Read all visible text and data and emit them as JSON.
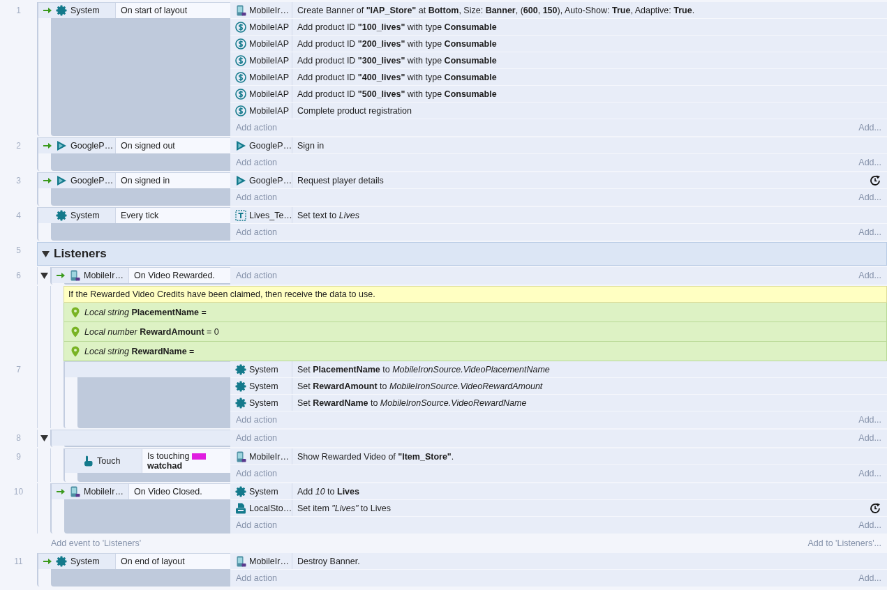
{
  "events": [
    {
      "kind": "event",
      "number": "1",
      "trigger": true,
      "conditions": [
        {
          "kind": "system",
          "object": "System",
          "text": "On start of layout"
        }
      ],
      "actions": [
        {
          "kind": "ironsource",
          "object": "MobileIr…",
          "text": "Create Banner of **\"IAP_Store\"** at **Bottom**, Size: **Banner**, (**600**, **150**), Auto-Show: **True**, Adaptive: **True**.",
          "async": false
        },
        {
          "kind": "iap",
          "object": "MobileIAP",
          "text": "Add product ID **\"100_lives\"** with type **Consumable**",
          "async": false
        },
        {
          "kind": "iap",
          "object": "MobileIAP",
          "text": "Add product ID **\"200_lives\"** with type **Consumable**",
          "async": false
        },
        {
          "kind": "iap",
          "object": "MobileIAP",
          "text": "Add product ID **\"300_lives\"** with type **Consumable**",
          "async": false
        },
        {
          "kind": "iap",
          "object": "MobileIAP",
          "text": "Add product ID **\"400_lives\"** with type **Consumable**",
          "async": false
        },
        {
          "kind": "iap",
          "object": "MobileIAP",
          "text": "Add product ID **\"500_lives\"** with type **Consumable**",
          "async": false
        },
        {
          "kind": "iap",
          "object": "MobileIAP",
          "text": "Complete product registration",
          "async": false
        }
      ],
      "add_action": "Add action",
      "add_more": "Add..."
    },
    {
      "kind": "event",
      "number": "2",
      "trigger": true,
      "conditions": [
        {
          "kind": "play",
          "object": "GoogleP…",
          "text": "On signed out"
        }
      ],
      "actions": [
        {
          "kind": "play",
          "object": "GoogleP…",
          "text": "Sign in",
          "async": false
        }
      ],
      "add_action": "Add action",
      "add_more": "Add..."
    },
    {
      "kind": "event",
      "number": "3",
      "trigger": true,
      "conditions": [
        {
          "kind": "play",
          "object": "GoogleP…",
          "text": "On signed in"
        }
      ],
      "actions": [
        {
          "kind": "play",
          "object": "GoogleP…",
          "text": "Request player details",
          "async": true
        }
      ],
      "add_action": "Add action",
      "add_more": "Add..."
    },
    {
      "kind": "event",
      "number": "4",
      "trigger": false,
      "conditions": [
        {
          "kind": "system",
          "object": "System",
          "text": "Every tick"
        }
      ],
      "actions": [
        {
          "kind": "text",
          "object": "Lives_Te…",
          "text": "Set text to *Lives*",
          "async": false
        }
      ],
      "add_action": "Add action",
      "add_more": "Add..."
    },
    {
      "kind": "group",
      "number": "5",
      "title": "Listeners",
      "expanded": true,
      "add_event": "Add event to 'Listeners'",
      "add_to": "Add to 'Listeners'...",
      "children": [
        {
          "kind": "event",
          "number": "6",
          "trigger": true,
          "expanded": true,
          "conditions": [
            {
              "kind": "ironsource",
              "object": "MobileIr…",
              "text": "On Video Rewarded."
            }
          ],
          "add_action": "Add action",
          "add_more": "Add...",
          "children": [
            {
              "kind": "comment",
              "text": "If the Rewarded Video Credits have been claimed, then receive the data to use."
            },
            {
              "kind": "variable",
              "text": "*Local string* **PlacementName** ="
            },
            {
              "kind": "variable",
              "text": "*Local number* **RewardAmount** = 0"
            },
            {
              "kind": "variable",
              "text": "*Local string* **RewardName** ="
            },
            {
              "kind": "event",
              "number": "7",
              "actions": [
                {
                  "kind": "system",
                  "object": "System",
                  "text": "Set **PlacementName** to *MobileIronSource.VideoPlacementName*",
                  "async": false
                },
                {
                  "kind": "system",
                  "object": "System",
                  "text": "Set **RewardAmount** to *MobileIronSource.VideoRewardAmount*",
                  "async": false
                },
                {
                  "kind": "system",
                  "object": "System",
                  "text": "Set **RewardName** to *MobileIronSource.VideoRewardName*",
                  "async": false
                }
              ],
              "add_action": "Add action",
              "add_more": "Add..."
            }
          ]
        },
        {
          "kind": "event",
          "number": "8",
          "expanded": true,
          "add_action": "Add action",
          "add_more": "Add...",
          "children": [
            {
              "kind": "event",
              "number": "9",
              "trigger": false,
              "conditions": [
                {
                  "kind": "touch",
                  "object": "Touch",
                  "text": "Is touching",
                  "param": "watchad"
                }
              ],
              "actions": [
                {
                  "kind": "ironsource",
                  "object": "MobileIr…",
                  "text": "Show Rewarded Video of **\"Item_Store\"**.",
                  "async": false
                }
              ],
              "add_action": "Add action",
              "add_more": "Add..."
            }
          ]
        },
        {
          "kind": "event",
          "number": "10",
          "trigger": true,
          "conditions": [
            {
              "kind": "ironsource",
              "object": "MobileIr…",
              "text": "On Video Closed."
            }
          ],
          "actions": [
            {
              "kind": "system",
              "object": "System",
              "text": "Add *10* to **Lives**",
              "async": false
            },
            {
              "kind": "storage",
              "object": "LocalSto…",
              "text": "Set item *\"Lives\"* to Lives",
              "async": true
            }
          ],
          "add_action": "Add action",
          "add_more": "Add..."
        }
      ]
    },
    {
      "kind": "event",
      "number": "11",
      "trigger": true,
      "conditions": [
        {
          "kind": "system",
          "object": "System",
          "text": "On end of layout"
        }
      ],
      "actions": [
        {
          "kind": "ironsource",
          "object": "MobileIr…",
          "text": "Destroy Banner.",
          "async": false
        }
      ],
      "add_action": "Add action",
      "add_more": "Add..."
    }
  ]
}
